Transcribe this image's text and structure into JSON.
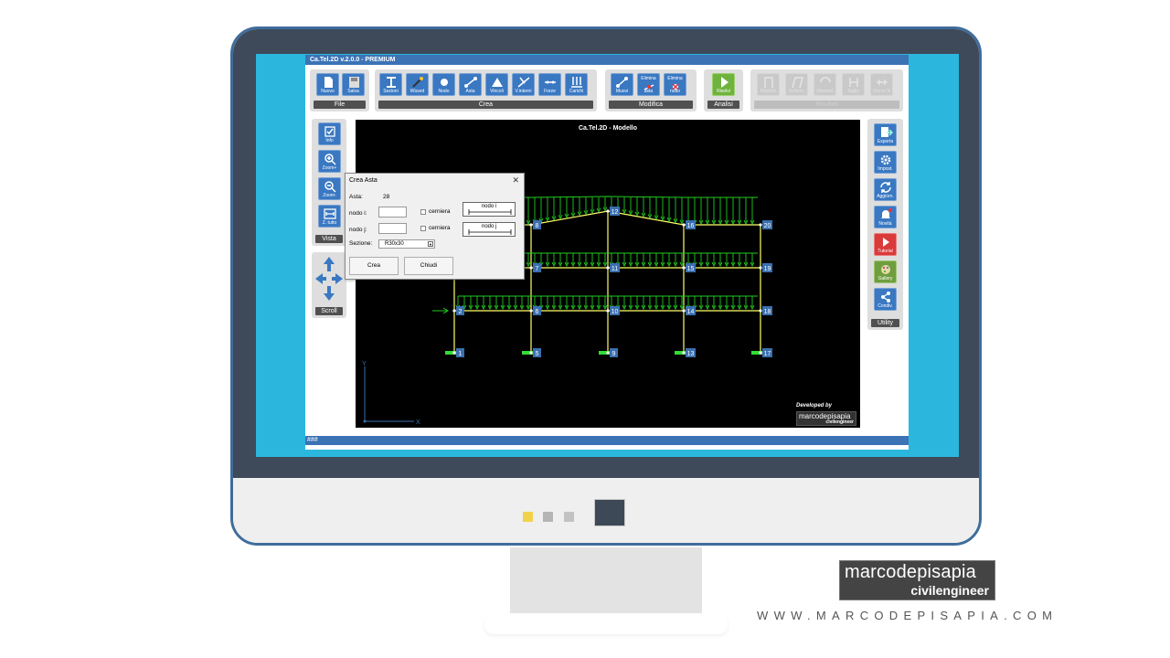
{
  "app": {
    "title": "Ca.Tel.2D v.2.0.0 - PREMIUM",
    "status": "###"
  },
  "ribbon": {
    "file": {
      "caption": "File",
      "buttons": [
        {
          "label": "Nuovo",
          "icon": "new-file-icon"
        },
        {
          "label": "Salva",
          "icon": "save-icon"
        }
      ]
    },
    "crea": {
      "caption": "Crea",
      "buttons": [
        {
          "label": "Sezioni",
          "icon": "section-icon"
        },
        {
          "label": "Wizard",
          "icon": "wizard-icon"
        },
        {
          "label": "Nodo",
          "icon": "node-icon"
        },
        {
          "label": "Asta",
          "icon": "beam-icon"
        },
        {
          "label": "Vincoli",
          "icon": "constraint-icon"
        },
        {
          "label": "V.interni",
          "icon": "internal-constraint-icon"
        },
        {
          "label": "Forze",
          "icon": "force-icon"
        },
        {
          "label": "Carichi",
          "icon": "loads-icon"
        }
      ]
    },
    "modifica": {
      "caption": "Modifica",
      "buttons": [
        {
          "label": "Muovi",
          "icon": "move-icon"
        },
        {
          "label_top": "Elimina",
          "label": "asta",
          "icon": "delete-beam-icon"
        },
        {
          "label_top": "Elimina",
          "label": "nodo",
          "icon": "delete-node-icon"
        }
      ]
    },
    "analisi": {
      "caption": "Analisi",
      "buttons": [
        {
          "label": "Risolvi",
          "icon": "play-icon"
        }
      ]
    },
    "risultati": {
      "caption": "Risultati",
      "buttons": [
        {
          "label": "Modello"
        },
        {
          "label": "Deform."
        },
        {
          "label": "Moment"
        },
        {
          "label": "Taglio"
        },
        {
          "label": "Sforzo N"
        }
      ]
    }
  },
  "vista": {
    "caption": "Vista",
    "buttons": [
      {
        "label": "Info",
        "icon": "checkbox-icon"
      },
      {
        "label": "Zoom+",
        "icon": "zoom-in-icon"
      },
      {
        "label": "Zoom-",
        "icon": "zoom-out-icon"
      },
      {
        "label": "Z. tutto",
        "icon": "zoom-all-icon"
      }
    ]
  },
  "scroll": {
    "caption": "Scroll"
  },
  "utility": {
    "caption": "Utility",
    "buttons": [
      {
        "label": "Esporta",
        "icon": "export-icon"
      },
      {
        "label": "Impost.",
        "icon": "gear-icon"
      },
      {
        "label": "Aggiorn.",
        "icon": "refresh-icon"
      },
      {
        "label": "Novità",
        "icon": "bell-icon"
      },
      {
        "label": "Tutorial",
        "icon": "play-icon"
      },
      {
        "label": "Gallery",
        "icon": "gallery-icon"
      },
      {
        "label": "Condiv.",
        "icon": "share-icon"
      }
    ]
  },
  "canvas": {
    "title": "Ca.Tel.2D - Modello",
    "axis_x": "X",
    "axis_y": "Y",
    "developed_by": "Developed by",
    "logo_name": "marcodepisapia",
    "logo_sub": "civilengineer",
    "nodes": [
      "1",
      "2",
      "5",
      "6",
      "7",
      "8",
      "9",
      "10",
      "11",
      "12",
      "13",
      "14",
      "15",
      "16",
      "17",
      "18",
      "19",
      "20"
    ]
  },
  "dialog": {
    "title": "Crea Asta",
    "asta_label": "Asta:",
    "asta_value": "28",
    "nodo_i_label": "nodo i:",
    "nodo_j_label": "nodo j:",
    "cerniera_label": "cerniera",
    "preview_i": "nodo i",
    "preview_j": "nodo j",
    "sezione_label": "Sezione:",
    "sezione_value": "R30x30",
    "crea_button": "Crea",
    "chiudi_button": "Chiudi"
  },
  "branding": {
    "name": "marcodepisapia",
    "sub": "civilengineer",
    "url": "WWW.MARCODEPISAPIA.COM"
  },
  "colors": {
    "accent": "#3b73b5",
    "frame_line": "#ffff66",
    "load_arrow": "#22cc22",
    "support": "#33dd33",
    "screen_bg": "#2bb7dd"
  }
}
